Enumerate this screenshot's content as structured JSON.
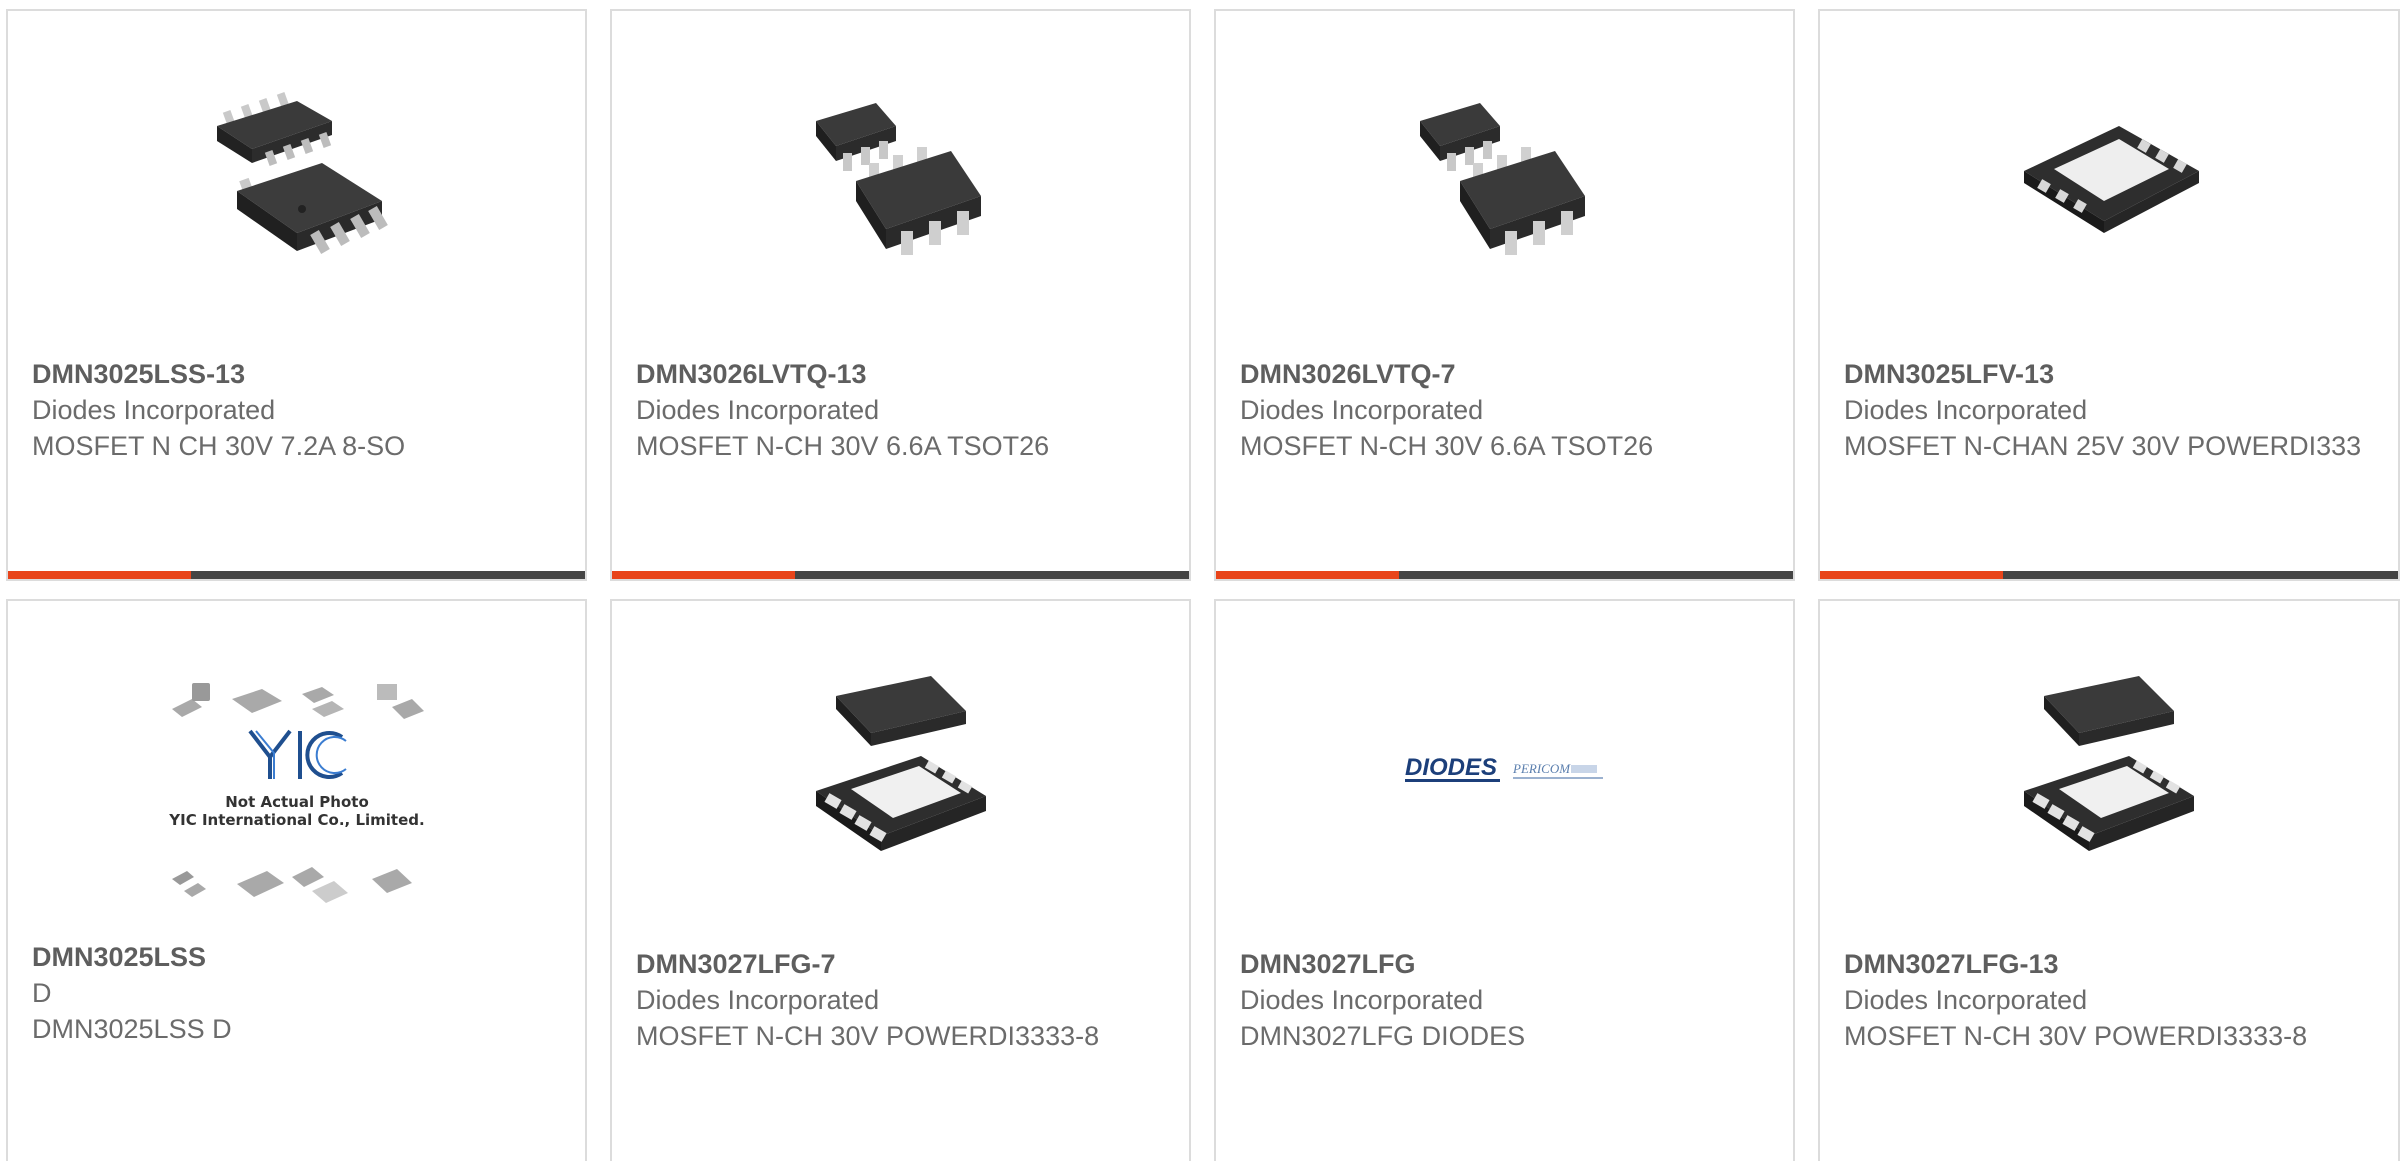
{
  "products": [
    {
      "part_number": "DMN3025LSS-13",
      "manufacturer": "Diodes Incorporated",
      "description": "MOSFET N CH 30V 7.2A 8-SO",
      "image": "so8-package-icon"
    },
    {
      "part_number": "DMN3026LVTQ-13",
      "manufacturer": "Diodes Incorporated",
      "description": "MOSFET N-CH 30V 6.6A TSOT26",
      "image": "tsot26-package-icon"
    },
    {
      "part_number": "DMN3026LVTQ-7",
      "manufacturer": "Diodes Incorporated",
      "description": "MOSFET N-CH 30V 6.6A TSOT26",
      "image": "tsot26-package-icon"
    },
    {
      "part_number": "DMN3025LFV-13",
      "manufacturer": "Diodes Incorporated",
      "description": "MOSFET N-CHAN 25V 30V POWERDI333",
      "image": "powerdi-package-icon"
    },
    {
      "part_number": "DMN3025LSS",
      "manufacturer": "D",
      "description": "DMN3025LSS D",
      "image": "not-actual-photo-icon",
      "image_caption": [
        "Not Actual Photo",
        "YIC International Co., Limited."
      ],
      "image_logo_text": "YIC"
    },
    {
      "part_number": "DMN3027LFG-7",
      "manufacturer": "Diodes Incorporated",
      "description": "MOSFET N-CH 30V POWERDI3333-8",
      "image": "dfn-package-icon"
    },
    {
      "part_number": "DMN3027LFG",
      "manufacturer": "Diodes Incorporated",
      "description": "DMN3027LFG DIODES",
      "image": "diodes-pericom-logo",
      "image_logo_text": [
        "DIODES",
        "PERICOM"
      ]
    },
    {
      "part_number": "DMN3027LFG-13",
      "manufacturer": "Diodes Incorporated",
      "description": "MOSFET N-CH 30V POWERDI3333-8",
      "image": "dfn-package-icon"
    }
  ],
  "colors": {
    "accent": "#e8441a",
    "bar": "#444444",
    "text": "#6b6b6b",
    "border": "#dcdcdc"
  }
}
